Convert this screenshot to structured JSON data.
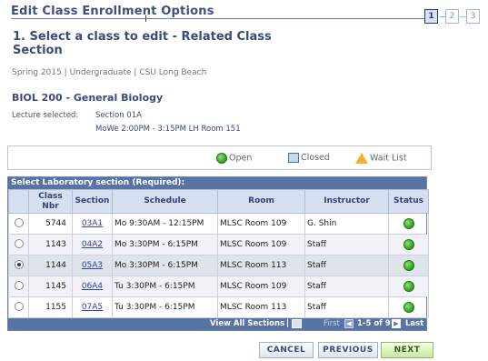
{
  "header": {
    "title": "Edit Class Enrollment Options",
    "steps": [
      "1",
      "2",
      "3"
    ],
    "active_step": 1
  },
  "step_heading": "1.  Select a class to edit - Related Class Section",
  "term_line": "Spring 2015 | Undergraduate | CSU Long Beach",
  "course": {
    "title": "BIOL  200 - General Biology",
    "lecture_label": "Lecture selected:",
    "lecture_section": "Section 01A",
    "lecture_time": "MoWe 2:00PM - 3:15PM   LH  Room 151"
  },
  "legend": {
    "open": "Open",
    "closed": "Closed",
    "wait_list": "Wait List"
  },
  "grid": {
    "caption": "Select Laboratory section (Required):",
    "columns": [
      "",
      "Class Nbr",
      "Section",
      "Schedule",
      "Room",
      "Instructor",
      "Status"
    ],
    "rows": [
      {
        "nbr": "5744",
        "section": "03A1",
        "schedule": "Mo 9:30AM - 12:15PM",
        "room": "MLSC Room 109",
        "instructor": "G. Shin",
        "status": "Open",
        "selected": false
      },
      {
        "nbr": "1143",
        "section": "04A2",
        "schedule": "Mo 3:30PM - 6:15PM",
        "room": "MLSC Room 109",
        "instructor": "Staff",
        "status": "Open",
        "selected": false
      },
      {
        "nbr": "1144",
        "section": "05A3",
        "schedule": "Mo 3:30PM - 6:15PM",
        "room": "MLSC Room 113",
        "instructor": "Staff",
        "status": "Open",
        "selected": true
      },
      {
        "nbr": "1145",
        "section": "06A4",
        "schedule": "Tu 3:30PM - 6:15PM",
        "room": "MLSC Room 109",
        "instructor": "Staff",
        "status": "Open",
        "selected": false
      },
      {
        "nbr": "1155",
        "section": "07A5",
        "schedule": "Tu 3:30PM - 6:15PM",
        "room": "MLSC Room 113",
        "instructor": "Staff",
        "status": "Open",
        "selected": false
      }
    ],
    "footer": {
      "view_all": "View All Sections",
      "separator": "|",
      "first": "First",
      "range": "1-5 of 9",
      "last": "Last"
    }
  },
  "buttons": {
    "cancel": "CANCEL",
    "previous": "PREVIOUS",
    "next": "NEXT"
  },
  "colors": {
    "accent": "#3b4a7a",
    "grid_header": "#5874a5",
    "open_status": "#2e9e1a"
  }
}
